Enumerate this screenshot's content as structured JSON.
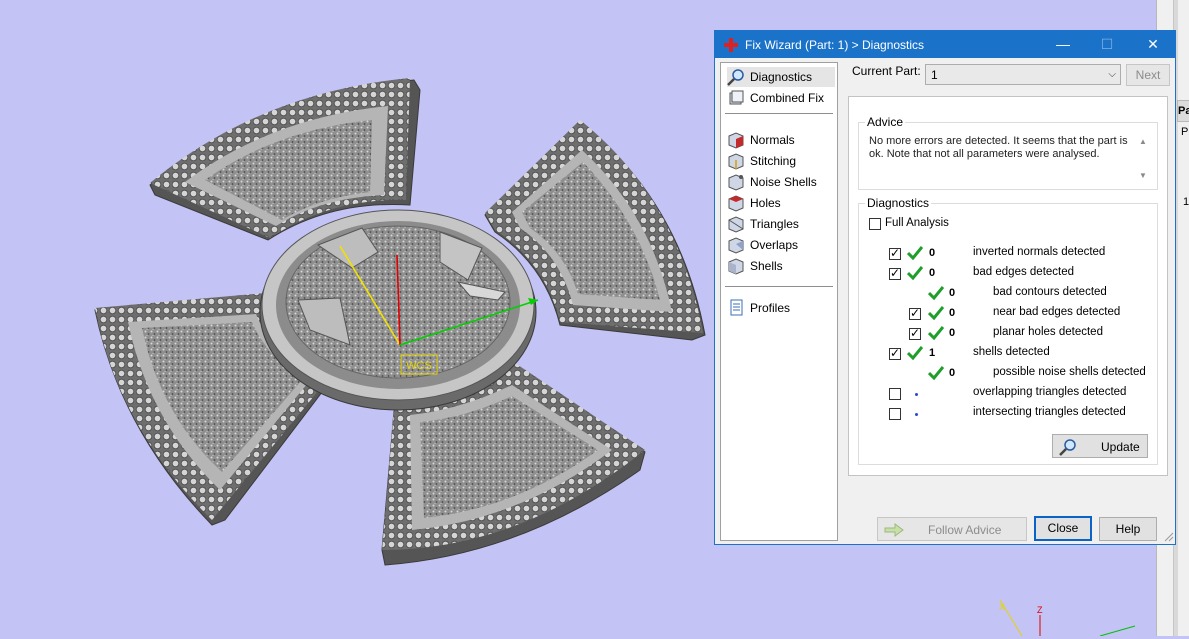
{
  "dialog": {
    "title": "Fix Wizard (Part: 1) > Diagnostics",
    "controls": {
      "minimize": "—",
      "maximize": "☐",
      "close": "✕"
    }
  },
  "nav": {
    "items": [
      {
        "label": "Diagnostics",
        "icon": "magnifier-icon"
      },
      {
        "label": "Combined Fix",
        "icon": "combined-fix-icon"
      },
      {
        "label": "Normals",
        "icon": "normals-cube-icon"
      },
      {
        "label": "Stitching",
        "icon": "stitching-cube-icon"
      },
      {
        "label": "Noise Shells",
        "icon": "noise-shells-icon"
      },
      {
        "label": "Holes",
        "icon": "holes-cube-icon"
      },
      {
        "label": "Triangles",
        "icon": "triangles-icon"
      },
      {
        "label": "Overlaps",
        "icon": "overlaps-icon"
      },
      {
        "label": "Shells",
        "icon": "shells-icon"
      },
      {
        "label": "Profiles",
        "icon": "profiles-icon"
      }
    ]
  },
  "current_part": {
    "label": "Current Part:",
    "value": "1",
    "next_label": "Next"
  },
  "advice": {
    "legend": "Advice",
    "text": "No more errors are detected. It seems that the part is ok. Note that not all parameters were analysed."
  },
  "diagnostics": {
    "legend": "Diagnostics",
    "full_analysis_label": "Full Analysis",
    "rows": [
      {
        "checked": true,
        "status": "ok",
        "count": "0",
        "text": "inverted normals detected",
        "indent": 0,
        "has_checkbox": true
      },
      {
        "checked": true,
        "status": "ok",
        "count": "0",
        "text": "bad edges detected",
        "indent": 0,
        "has_checkbox": true
      },
      {
        "checked": false,
        "status": "ok",
        "count": "0",
        "text": "bad contours detected",
        "indent": 1,
        "has_checkbox": false
      },
      {
        "checked": true,
        "status": "ok",
        "count": "0",
        "text": "near bad edges detected",
        "indent": 1,
        "has_checkbox": true
      },
      {
        "checked": true,
        "status": "ok",
        "count": "0",
        "text": "planar holes detected",
        "indent": 1,
        "has_checkbox": true
      },
      {
        "checked": true,
        "status": "ok",
        "count": "1",
        "text": "shells detected",
        "indent": 0,
        "has_checkbox": true
      },
      {
        "checked": false,
        "status": "ok",
        "count": "0",
        "text": "possible noise shells detected",
        "indent": 1,
        "has_checkbox": false
      },
      {
        "checked": false,
        "status": "none",
        "count": "",
        "text": "overlapping triangles detected",
        "indent": 0,
        "has_checkbox": true
      },
      {
        "checked": false,
        "status": "none",
        "count": "",
        "text": "intersecting triangles detected",
        "indent": 0,
        "has_checkbox": true
      }
    ],
    "update_label": "Update"
  },
  "footer": {
    "follow_advice": "Follow Advice",
    "close": "Close",
    "help": "Help"
  },
  "viewport": {
    "wcs_label": "WCS"
  },
  "side_strip": {
    "tab": "Pa",
    "t2": "P",
    "t3": "1"
  },
  "colors": {
    "viewport_bg": "#c3c3f5",
    "titlebar": "#1b73c9",
    "ok_green": "#1f9e2a",
    "part_gray": "#8a8a8a"
  }
}
